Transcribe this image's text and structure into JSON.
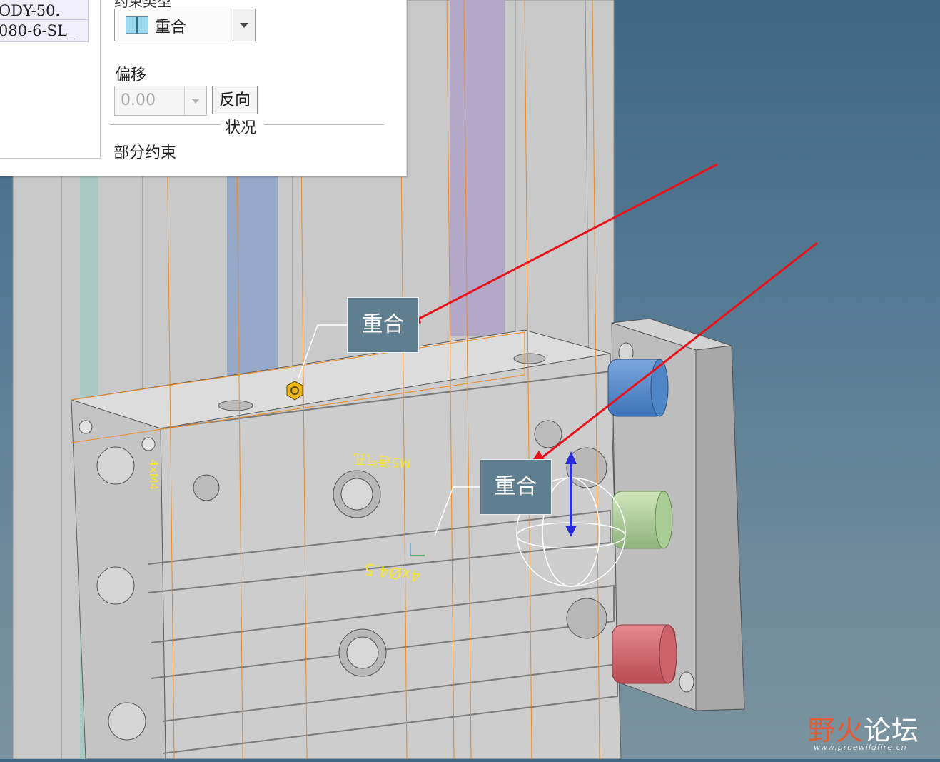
{
  "panel": {
    "list_items": [
      "ODY-50.",
      "080-6-SL_"
    ],
    "constraint_type_label": "约束类型",
    "constraint_type_value": "重合",
    "offset_label": "偏移",
    "offset_value": "0.00",
    "reverse_button_label": "反向",
    "status_section_title": "状况",
    "status_text": "部分约束"
  },
  "viewport": {
    "callout_top": "重合",
    "callout_right": "重合",
    "model_annotations": [
      "M5通气孔",
      "4xØ4.5",
      "4xM4"
    ]
  },
  "watermark": {
    "text_part1": "野火",
    "text_part2": "论坛",
    "url": "www.proewildfire.cn"
  },
  "colors": {
    "background_top": "#3f6783",
    "background_bottom": "#7b93a0",
    "callout_fill": "#5f7e8f",
    "annotation_arrow": "#e8131a",
    "model_edge_orange": "#f08a24",
    "annotation_text_yellow": "#f5e23a",
    "drag_handle_blue": "#2a2ae0"
  }
}
